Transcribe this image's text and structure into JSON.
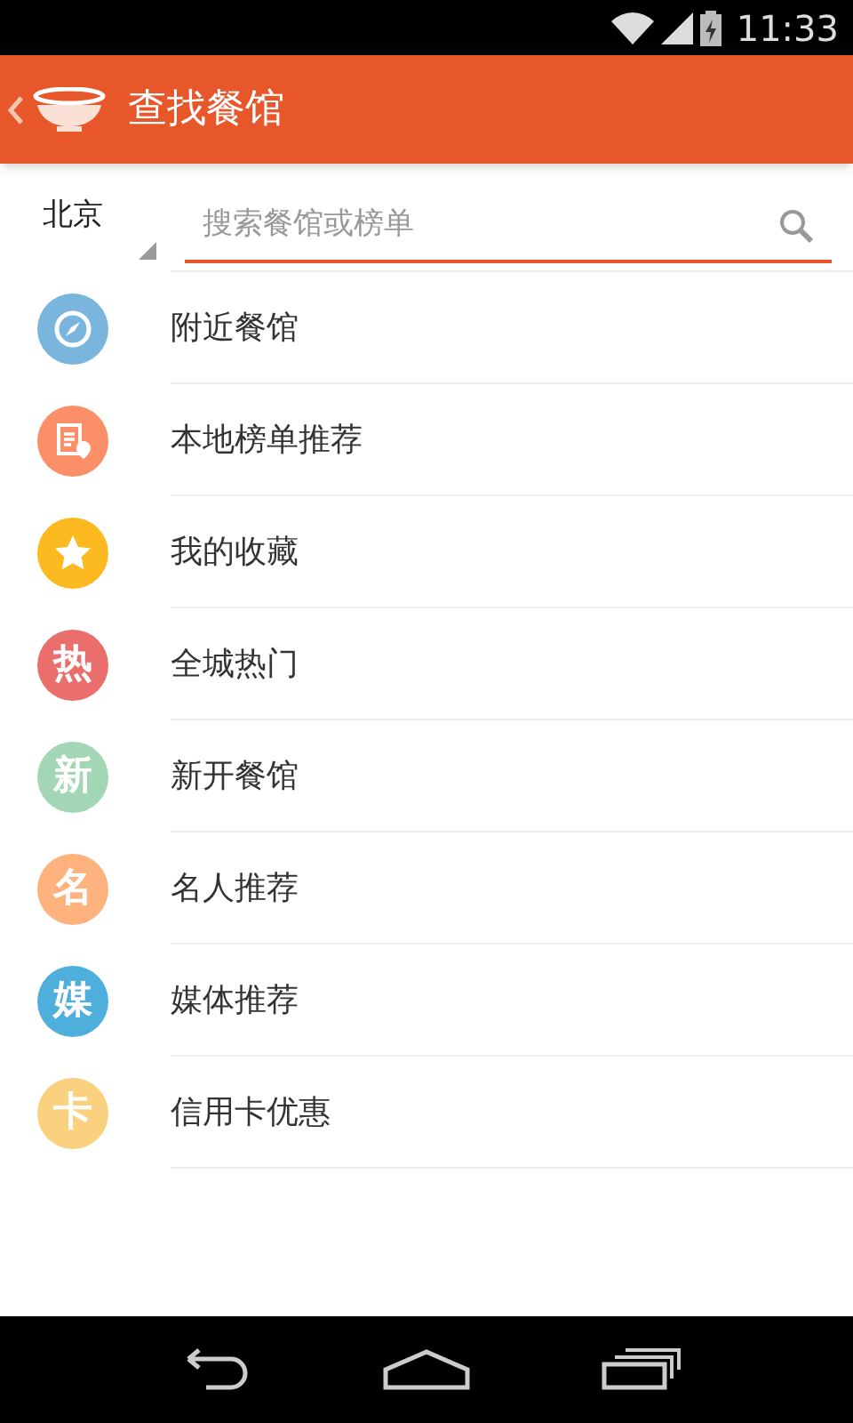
{
  "status_bar": {
    "time": "11:33"
  },
  "app_bar": {
    "title": "查找餐馆"
  },
  "search": {
    "city": "北京",
    "placeholder": "搜索餐馆或榜单"
  },
  "items": [
    {
      "kind": "compass",
      "label": "附近餐馆",
      "color": "#7ab5de"
    },
    {
      "kind": "list-pin",
      "label": "本地榜单推荐",
      "color": "#fb8f68"
    },
    {
      "kind": "star",
      "label": "我的收藏",
      "color": "#fdb920"
    },
    {
      "kind": "glyph",
      "glyph": "热",
      "label": "全城热门",
      "color": "#ea6f6c"
    },
    {
      "kind": "glyph",
      "glyph": "新",
      "label": "新开餐馆",
      "color": "#a2d6b4"
    },
    {
      "kind": "glyph",
      "glyph": "名",
      "label": "名人推荐",
      "color": "#feb37e"
    },
    {
      "kind": "glyph",
      "glyph": "媒",
      "label": "媒体推荐",
      "color": "#4eaedc"
    },
    {
      "kind": "glyph",
      "glyph": "卡",
      "label": "信用卡优惠",
      "color": "#fad17e"
    }
  ]
}
